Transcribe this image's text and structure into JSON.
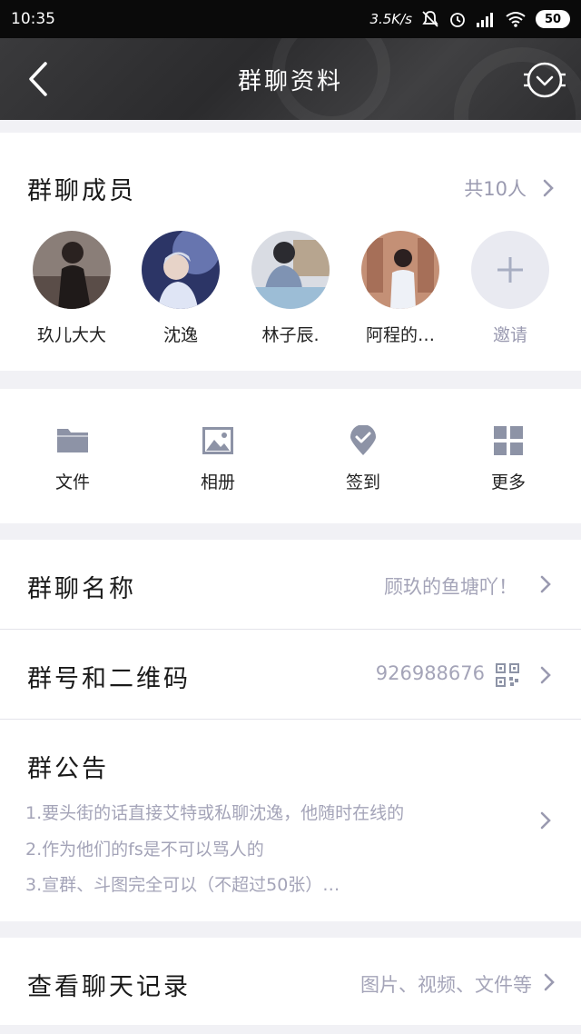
{
  "status_bar": {
    "time": "10:35",
    "net_speed": "3.5K/s",
    "battery": "50"
  },
  "header": {
    "title": "群聊资料",
    "back_icon": "chevron-left-icon",
    "menu_icon": "circle-chevron-down-icon"
  },
  "members": {
    "title": "群聊成员",
    "count_text": "共10人",
    "list": [
      {
        "name": "玖儿大大",
        "avatar_color": "#6b5a55"
      },
      {
        "name": "沈逸",
        "avatar_color": "#2c3566"
      },
      {
        "name": "林子辰.",
        "avatar_color": "#7c8aa0"
      },
      {
        "name": "阿程的…",
        "avatar_color": "#c08a72"
      }
    ],
    "invite_label": "邀请"
  },
  "tools": [
    {
      "label": "文件",
      "icon": "folder-icon"
    },
    {
      "label": "相册",
      "icon": "image-icon"
    },
    {
      "label": "签到",
      "icon": "location-check-icon"
    },
    {
      "label": "更多",
      "icon": "grid-icon"
    }
  ],
  "group_name": {
    "title": "群聊名称",
    "value": "顾玖的鱼塘吖！"
  },
  "group_number": {
    "title": "群号和二维码",
    "value": "926988676"
  },
  "notice": {
    "title": "群公告",
    "lines": [
      "1.要头街的话直接艾特或私聊沈逸，他随时在线的",
      "2.作为他们的fs是不可以骂人的",
      "3.宣群、斗图完全可以（不超过50张）…"
    ]
  },
  "history": {
    "title": "查看聊天记录",
    "value": "图片、视频、文件等"
  },
  "colors": {
    "accent_muted": "#9a9ab0",
    "icon_gray": "#8d93a6"
  }
}
